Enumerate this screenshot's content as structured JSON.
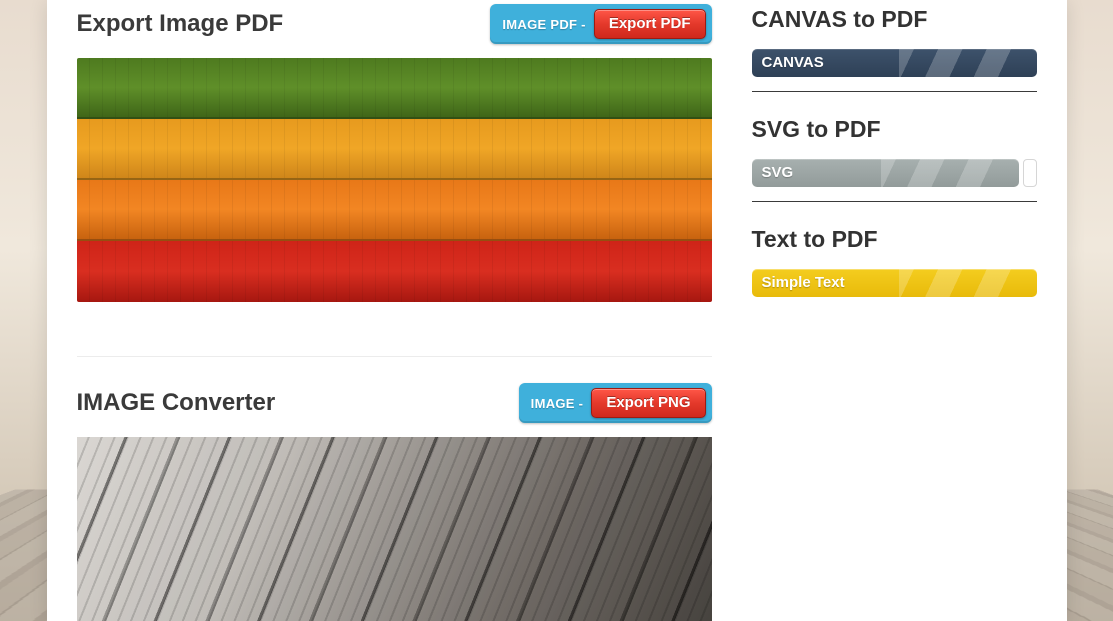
{
  "main": {
    "sections": [
      {
        "title": "Export Image PDF",
        "export_prefix": "IMAGE PDF -",
        "export_button": "Export PDF"
      },
      {
        "title": "IMAGE Converter",
        "export_prefix": "IMAGE -",
        "export_button": "Export PNG"
      }
    ]
  },
  "sidebar": {
    "blocks": [
      {
        "title": "CANVAS to PDF",
        "band_label": "CANVAS"
      },
      {
        "title": "SVG to PDF",
        "band_label": "SVG"
      },
      {
        "title": "Text to PDF",
        "band_label": "Simple Text"
      }
    ]
  }
}
